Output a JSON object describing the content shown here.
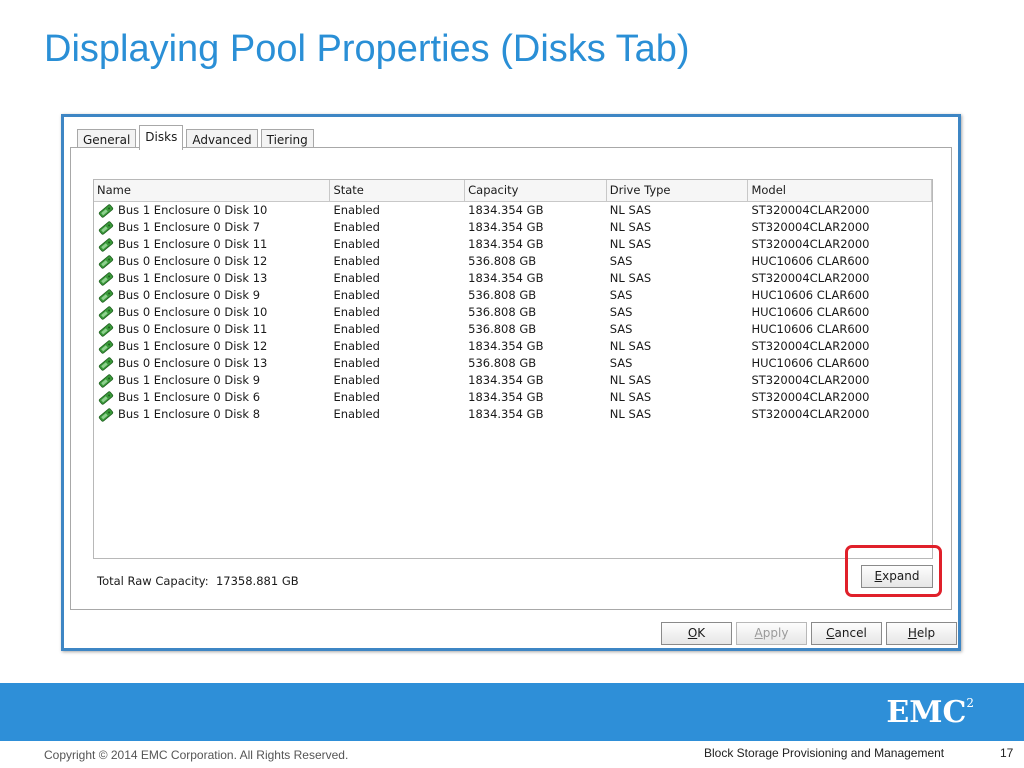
{
  "slide": {
    "title": "Displaying Pool Properties (Disks Tab)",
    "copyright": "Copyright © 2014 EMC Corporation. All Rights Reserved.",
    "course": "Block Storage Provisioning and Management",
    "page_number": "17",
    "logo_text": "EMC",
    "logo_superscript": "2"
  },
  "dialog": {
    "tabs": [
      {
        "label": "General",
        "active": false
      },
      {
        "label": "Disks",
        "active": true
      },
      {
        "label": "Advanced",
        "active": false
      },
      {
        "label": "Tiering",
        "active": false
      }
    ],
    "table": {
      "columns": [
        "Name",
        "State",
        "Capacity",
        "Drive Type",
        "Model"
      ],
      "rows": [
        [
          "Bus 1 Enclosure 0 Disk 10",
          "Enabled",
          "1834.354 GB",
          "NL SAS",
          "ST320004CLAR2000"
        ],
        [
          "Bus 1 Enclosure 0 Disk 7",
          "Enabled",
          "1834.354 GB",
          "NL SAS",
          "ST320004CLAR2000"
        ],
        [
          "Bus 1 Enclosure 0 Disk 11",
          "Enabled",
          "1834.354 GB",
          "NL SAS",
          "ST320004CLAR2000"
        ],
        [
          "Bus 0 Enclosure 0 Disk 12",
          "Enabled",
          "536.808 GB",
          "SAS",
          "HUC10606 CLAR600"
        ],
        [
          "Bus 1 Enclosure 0 Disk 13",
          "Enabled",
          "1834.354 GB",
          "NL SAS",
          "ST320004CLAR2000"
        ],
        [
          "Bus 0 Enclosure 0 Disk 9",
          "Enabled",
          "536.808 GB",
          "SAS",
          "HUC10606 CLAR600"
        ],
        [
          "Bus 0 Enclosure 0 Disk 10",
          "Enabled",
          "536.808 GB",
          "SAS",
          "HUC10606 CLAR600"
        ],
        [
          "Bus 0 Enclosure 0 Disk 11",
          "Enabled",
          "536.808 GB",
          "SAS",
          "HUC10606 CLAR600"
        ],
        [
          "Bus 1 Enclosure 0 Disk 12",
          "Enabled",
          "1834.354 GB",
          "NL SAS",
          "ST320004CLAR2000"
        ],
        [
          "Bus 0 Enclosure 0 Disk 13",
          "Enabled",
          "536.808 GB",
          "SAS",
          "HUC10606 CLAR600"
        ],
        [
          "Bus 1 Enclosure 0 Disk 9",
          "Enabled",
          "1834.354 GB",
          "NL SAS",
          "ST320004CLAR2000"
        ],
        [
          "Bus 1 Enclosure 0 Disk 6",
          "Enabled",
          "1834.354 GB",
          "NL SAS",
          "ST320004CLAR2000"
        ],
        [
          "Bus 1 Enclosure 0 Disk 8",
          "Enabled",
          "1834.354 GB",
          "NL SAS",
          "ST320004CLAR2000"
        ]
      ]
    },
    "total_raw_capacity_label": "Total Raw Capacity:",
    "total_raw_capacity_value": "17358.881 GB",
    "buttons": {
      "expand": {
        "mnemonic": "E",
        "rest": "xpand"
      },
      "ok": {
        "mnemonic": "O",
        "rest": "K"
      },
      "apply": {
        "mnemonic": "A",
        "rest": "pply",
        "disabled": true
      },
      "cancel": {
        "mnemonic": "C",
        "rest": "ancel"
      },
      "help": {
        "mnemonic": "H",
        "rest": "elp"
      }
    }
  },
  "colors": {
    "title": "#2a8fd6",
    "footer_bar": "#2e8fd8",
    "dialog_border": "#3e86c4",
    "highlight": "#e0202a",
    "disk_icon": "#3a9a3a"
  },
  "icons": {
    "disk": "green-disk-drive-icon"
  }
}
